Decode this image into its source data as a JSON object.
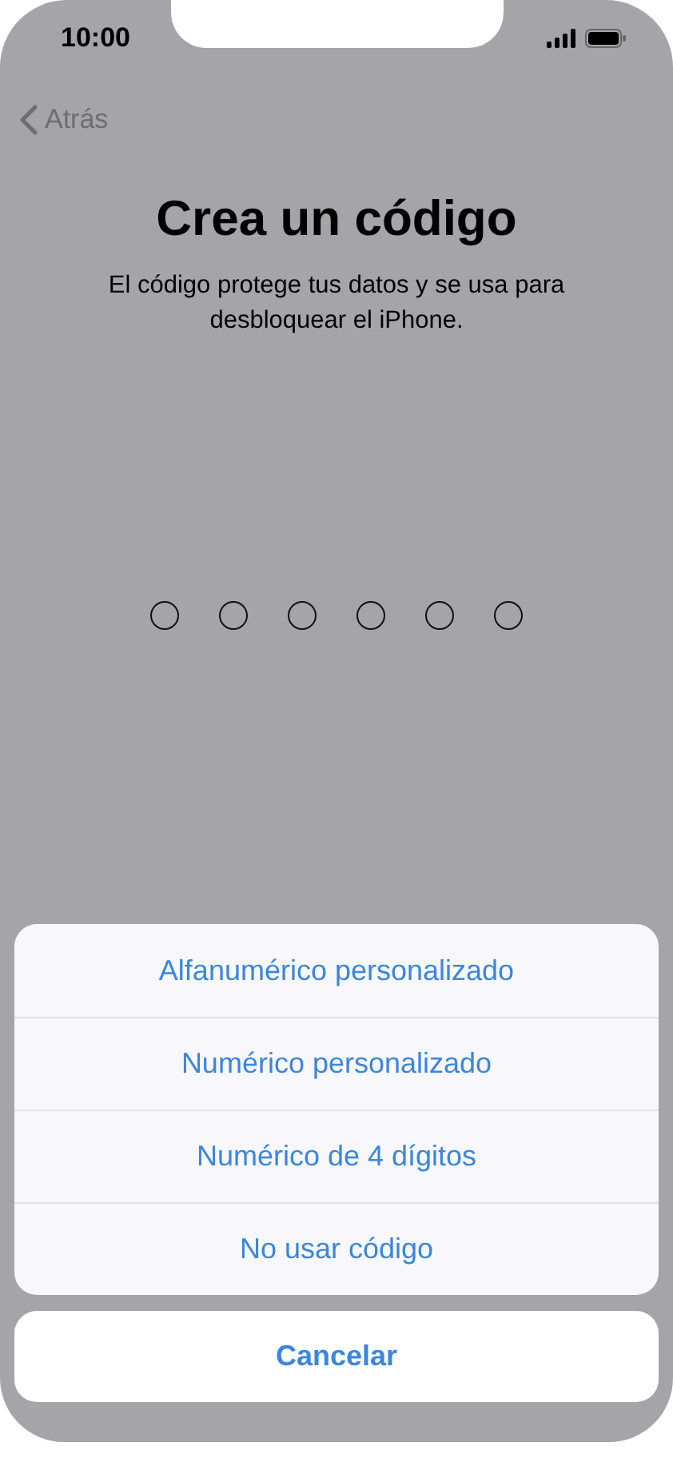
{
  "status_bar": {
    "time": "10:00"
  },
  "nav": {
    "back": "Atrás"
  },
  "title": "Crea un código",
  "subtitle": "El código protege tus datos y se usa para desbloquear el iPhone.",
  "passcode_dots": [
    {
      "filled": false
    },
    {
      "filled": false
    },
    {
      "filled": false
    },
    {
      "filled": false
    },
    {
      "filled": false
    },
    {
      "filled": false
    }
  ],
  "action_sheet": {
    "options": [
      "Alfanumérico personalizado",
      "Numérico personalizado",
      "Numérico de 4 dígitos",
      "No usar código"
    ],
    "cancel": "Cancelar"
  }
}
